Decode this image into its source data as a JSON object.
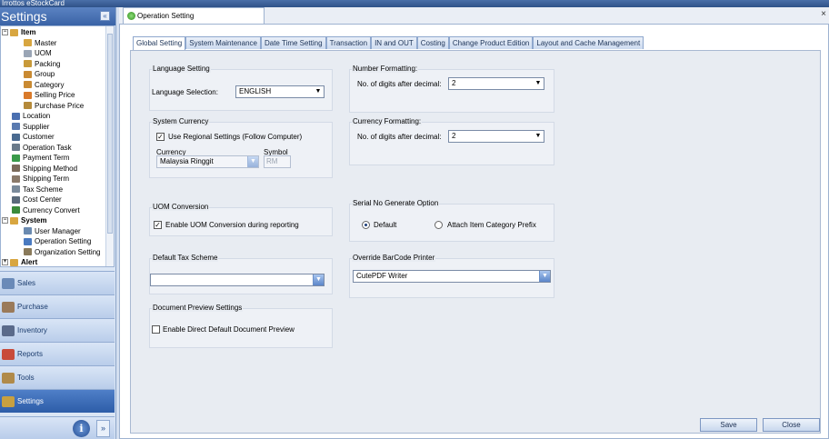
{
  "window": {
    "title": "Irrottos eStockCard"
  },
  "sidebar": {
    "header": "Settings",
    "collapse_glyph": "«",
    "tree": [
      {
        "label": "Item",
        "level": 0,
        "bold": true,
        "expander": "−",
        "icon_color": "#d8a640"
      },
      {
        "label": "Master",
        "level": 1,
        "icon_color": "#d8a640"
      },
      {
        "label": "UOM",
        "level": 1,
        "icon_color": "#9aa5b5"
      },
      {
        "label": "Packing",
        "level": 1,
        "icon_color": "#c89a3a"
      },
      {
        "label": "Group",
        "level": 1,
        "icon_color": "#c98a32"
      },
      {
        "label": "Category",
        "level": 1,
        "icon_color": "#c98a32"
      },
      {
        "label": "Selling Price",
        "level": 1,
        "icon_color": "#d97a2a"
      },
      {
        "label": "Purchase Price",
        "level": 1,
        "icon_color": "#b58a3a"
      },
      {
        "label": "Location",
        "level": 0,
        "icon_color": "#4a6fb0"
      },
      {
        "label": "Supplier",
        "level": 0,
        "icon_color": "#5a7ab0"
      },
      {
        "label": "Customer",
        "level": 0,
        "icon_color": "#4a6a90"
      },
      {
        "label": "Operation Task",
        "level": 0,
        "icon_color": "#6a7a8a"
      },
      {
        "label": "Payment Term",
        "level": 0,
        "icon_color": "#3a9a4a"
      },
      {
        "label": "Shipping Method",
        "level": 0,
        "icon_color": "#7a6a5a"
      },
      {
        "label": "Shipping Term",
        "level": 0,
        "icon_color": "#8a7a6a"
      },
      {
        "label": "Tax Scheme",
        "level": 0,
        "icon_color": "#7a8a9a"
      },
      {
        "label": "Cost Center",
        "level": 0,
        "icon_color": "#5a6a7a"
      },
      {
        "label": "Currency Convert",
        "level": 0,
        "icon_color": "#3a8a3a"
      },
      {
        "label": "System",
        "level": 0,
        "bold": true,
        "expander": "−",
        "icon_color": "#d8a640"
      },
      {
        "label": "User Manager",
        "level": 1,
        "icon_color": "#6a8ab0"
      },
      {
        "label": "Operation Setting",
        "level": 1,
        "icon_color": "#4a7ac0"
      },
      {
        "label": "Organization Setting",
        "level": 1,
        "icon_color": "#8a7a5a"
      },
      {
        "label": "Alert",
        "level": 0,
        "bold": true,
        "expander": "+",
        "icon_color": "#d8a640"
      }
    ],
    "nav": [
      {
        "label": "Sales",
        "icon_color": "#6a8ab8",
        "active": false
      },
      {
        "label": "Purchase",
        "icon_color": "#9a7a5a",
        "active": false
      },
      {
        "label": "Inventory",
        "icon_color": "#5a6a8a",
        "active": false
      },
      {
        "label": "Reports",
        "icon_color": "#c84a3a",
        "active": false
      },
      {
        "label": "Tools",
        "icon_color": "#b08a4a",
        "active": false
      },
      {
        "label": "Settings",
        "icon_color": "#c8a040",
        "active": true
      }
    ],
    "info_glyph": "i",
    "more_glyph": "»"
  },
  "document_tab": {
    "label": "Operation Setting",
    "close_glyph": "×"
  },
  "tabs": [
    "Global Setting",
    "System Maintenance",
    "Date Time Setting",
    "Transaction",
    "IN and OUT",
    "Costing",
    "Change Product Edition",
    "Layout and Cache Management"
  ],
  "active_tab": 0,
  "language": {
    "group_title": "Language Setting",
    "label": "Language Selection:",
    "value": "ENGLISH"
  },
  "currency": {
    "group_title": "System Currency",
    "use_regional_label": "Use Regional Settings (Follow Computer)",
    "use_regional_checked": true,
    "currency_label": "Currency",
    "currency_value": "Malaysia Ringgit",
    "symbol_label": "Symbol",
    "symbol_value": "RM"
  },
  "uom": {
    "group_title": "UOM Conversion",
    "enable_label": "Enable UOM Conversion during reporting",
    "enable_checked": true
  },
  "tax": {
    "group_title": "Default Tax Scheme",
    "value": ""
  },
  "preview": {
    "group_title": "Document Preview Settings",
    "enable_label": "Enable Direct Default Document Preview",
    "enable_checked": false
  },
  "number_format": {
    "group_title": "Number Formatting:",
    "digits_label": "No. of digits after decimal:",
    "digits_value": "2"
  },
  "currency_format": {
    "group_title": "Currency Formatting:",
    "digits_label": "No. of digits after decimal:",
    "digits_value": "2"
  },
  "serial": {
    "group_title": "Serial No Generate Option",
    "default_label": "Default",
    "attach_label": "Attach Item Category Prefix",
    "selected": "default"
  },
  "barcode": {
    "group_title": "Override BarCode Printer",
    "value": "CutePDF Writer"
  },
  "buttons": {
    "save": "Save",
    "close": "Close"
  },
  "glyphs": {
    "dropdown": "▼",
    "check": "✓"
  }
}
